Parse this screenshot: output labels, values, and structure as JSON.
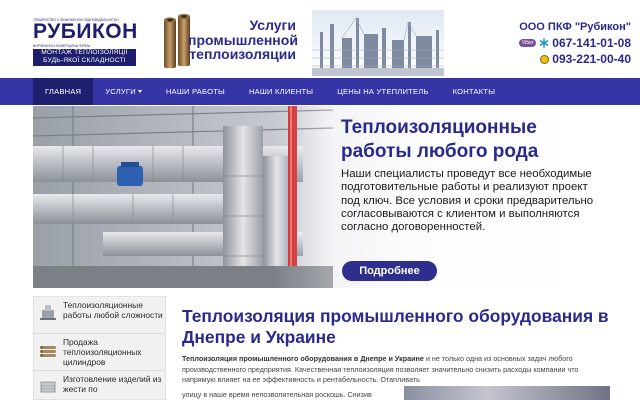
{
  "header": {
    "logo": {
      "tagline": "ТОВАРИСТВО З ОБМЕЖЕНОЮ ВІДПОВІДАЛЬНІСТЮ",
      "brand": "РУБИКОН",
      "subline": "ВИРОБНИЧО-КОМЕРЦІЙНА ФІРМА",
      "box_line1": "МОНТАЖ ТЕПЛОІЗОЛЯЦІЇ",
      "box_line2": "БУДЬ-ЯКОЇ СКЛАДНОСТІ"
    },
    "service_line1": "Услуги",
    "service_line2": "промышленной",
    "service_line3": "теплоизоляции",
    "company": "ООО ПКФ \"Рубикон\"",
    "phones": [
      {
        "number": "067-141-01-08",
        "icon": "viber-icon",
        "icon_text": "Viber"
      },
      {
        "number": "093-221-00-40",
        "icon": "phone-icon"
      }
    ]
  },
  "nav": {
    "items": [
      {
        "label": "ГЛАВНАЯ",
        "active": true
      },
      {
        "label": "УСЛУГИ",
        "dropdown": true
      },
      {
        "label": "НАШИ РАБОТЫ"
      },
      {
        "label": "НАШИ КЛИЕНТЫ"
      },
      {
        "label": "ЦЕНЫ НА УТЕПЛИТЕЛЬ"
      },
      {
        "label": "КОНТАКТЫ"
      }
    ]
  },
  "banner": {
    "title": "Теплоизоляционные работы любого рода",
    "text": "Наши специалисты проведут все необходимые подготовительные работы и реализуют проект под ключ. Все условия и сроки предварительно согласовываются с клиентом и выполняются согласно договоренностей.",
    "button": "Подробнее"
  },
  "sidebar": {
    "items": [
      {
        "label": "Теплоизоляционные работы любой сложности",
        "icon": "pipe-icon"
      },
      {
        "label": "Продажа теплоизоляционных цилиндров",
        "icon": "cylinders-icon"
      },
      {
        "label": "Изготовление изделий из жести по",
        "icon": "sheet-metal-icon"
      }
    ]
  },
  "main": {
    "title": "Теплоизоляция промышленного оборудования в Днепре  и Украине",
    "intro_bold": "Теплоизоляция промышленного оборудования в Днепре и Украине",
    "intro_rest": " и не только одна из основных задач любого производственного предприятия. Качественная теплоизоляция позволяет значительно снизить расходы компании что напрямую влияет на ее эффективность и рентабельность. Отапливать",
    "continued": "улицу в наше время непозволительная роскошь. Снизив"
  },
  "colors": {
    "brand": "#2a2a8c",
    "nav": "#3535a6",
    "nav_active": "#1f1f6f"
  }
}
